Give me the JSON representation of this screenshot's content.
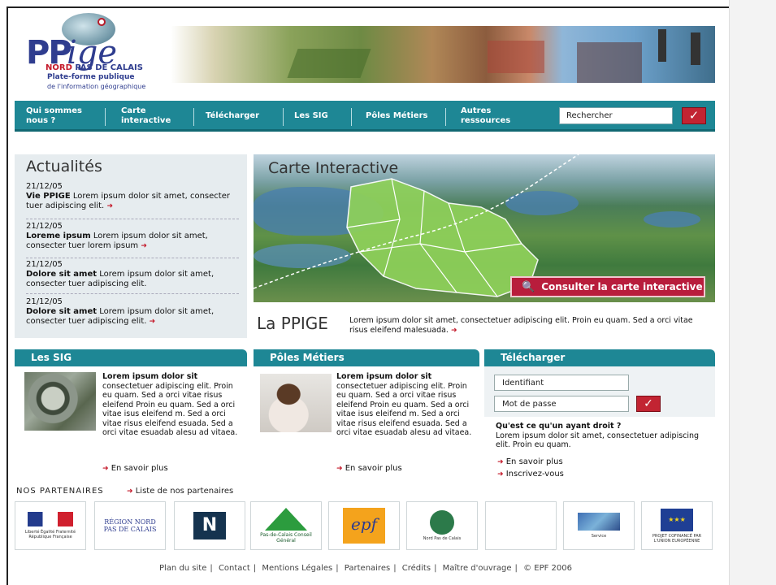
{
  "header": {
    "logo_pp": "PP",
    "logo_ige": "ige",
    "logo_nord": "NORD",
    "logo_pdc": "PAS DE CALAIS",
    "logo_line1": "Plate-forme publique",
    "logo_line2": "de l'information géographique"
  },
  "nav": {
    "items": [
      {
        "label": "Qui sommes nous ?"
      },
      {
        "label": "Carte interactive"
      },
      {
        "label": "Télécharger"
      },
      {
        "label": "Les SIG"
      },
      {
        "label": "Pôles Métiers"
      },
      {
        "label": "Autres ressources"
      }
    ],
    "search_value": "Rechercher",
    "search_button": "✓"
  },
  "news": {
    "title": "Actualités",
    "items": [
      {
        "date": "21/12/05",
        "bold": "Vie PPIGE",
        "text": " Lorem ipsum dolor sit amet, consecter tuer adipiscing elit."
      },
      {
        "date": "21/12/05",
        "bold": "Loreme ipsum",
        "text": " Lorem ipsum dolor sit amet, consecter tuer lorem ipsum"
      },
      {
        "date": "21/12/05",
        "bold": "Dolore sit amet",
        "text": " Lorem ipsum dolor sit amet, consecter tuer adipiscing elit."
      },
      {
        "date": "21/12/05",
        "bold": "Dolore sit amet",
        "text": " Lorem ipsum dolor sit amet, consecter tuer adipiscing elit."
      }
    ]
  },
  "carte": {
    "title": "Carte Interactive",
    "button": "Consulter la carte interactive"
  },
  "ppige": {
    "title": "La PPIGE",
    "text": "Lorem ipsum dolor sit amet, consectetuer adipiscing elit. Proin eu quam. Sed a orci vitae risus eleifend malesuada."
  },
  "sig": {
    "header": "Les SIG",
    "bold": "Lorem ipsum dolor sit",
    "text": "consectetuer adipiscing elit. Proin eu quam. Sed a orci vitae risus eleifend Proin eu quam. Sed a orci vitae isus eleifend m. Sed a orci vitae risus eleifend esuada. Sed a orci vitae esuadab alesu ad vitaea.",
    "more": "En savoir plus"
  },
  "poles": {
    "header": "Pôles Métiers",
    "bold": "Lorem ipsum dolor sit",
    "text": "consectetuer adipiscing elit. Proin eu quam. Sed a orci vitae risus eleifend Proin eu quam. Sed a orci vitae isus eleifend m. Sed a orci vitae risus eleifend esuada. Sed a orci vitae esuadab alesu ad vitaea.",
    "more": "En savoir plus"
  },
  "telecharger": {
    "header": "Télécharger",
    "id_value": "Identifiant",
    "pwd_value": "Mot de passe",
    "question": "Qu'est ce qu'un ayant droit ?",
    "text": "Lorem ipsum dolor sit amet, consectetuer adipiscing elit. Proin eu quam.",
    "more": "En savoir plus",
    "register": "Inscrivez-vous"
  },
  "partners": {
    "label": "NOS PARTENAIRES",
    "link": "Liste de nos partenaires",
    "logos": [
      {
        "name": "Liberté Égalité Fraternité République Française"
      },
      {
        "name": "RÉGION NORD PAS DE CALAIS"
      },
      {
        "name": "N"
      },
      {
        "name": "Pas-de-Calais Conseil Général"
      },
      {
        "name": "epf"
      },
      {
        "name": "Nord Pas de Calais"
      },
      {
        "name": ""
      },
      {
        "name": "Service"
      },
      {
        "name": "PROJET COFINANCÉ PAR L'UNION EUROPÉENNE"
      }
    ]
  },
  "footer": {
    "links": [
      "Plan du site",
      "Contact",
      "Mentions Légales",
      "Partenaires",
      "Crédits",
      "Maître d'ouvrage",
      "© EPF 2006"
    ]
  },
  "colors": {
    "teal": "#1e8795",
    "red": "#c22432",
    "brand_blue": "#2f3d8f"
  }
}
